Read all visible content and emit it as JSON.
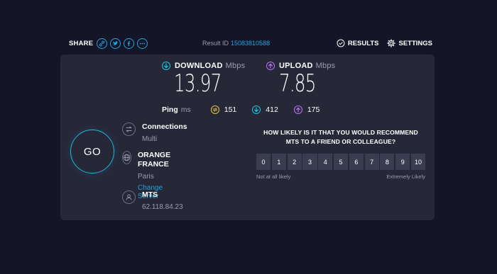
{
  "topbar": {
    "share_label": "SHARE",
    "share_buttons": [
      "link-icon",
      "twitter-icon",
      "facebook-icon",
      "more-icon"
    ],
    "result_id_label": "Result ID",
    "result_id": "15083810588",
    "results_label": "RESULTS",
    "settings_label": "SETTINGS"
  },
  "download": {
    "label": "DOWNLOAD",
    "unit": "Mbps",
    "value": "13.97",
    "color": "#19c8e0"
  },
  "upload": {
    "label": "UPLOAD",
    "unit": "Mbps",
    "value": "7.85",
    "color": "#b574f5"
  },
  "ping": {
    "label": "Ping",
    "unit": "ms",
    "idle": "151",
    "download": "412",
    "upload": "175",
    "idle_color": "#e6c547"
  },
  "go_label": "GO",
  "connections": {
    "title": "Connections",
    "value": "Multi"
  },
  "server": {
    "title": "ORANGE FRANCE",
    "location": "Paris",
    "change_label": "Change Server"
  },
  "provider": {
    "title": "MTS",
    "ip": "62.118.84.23"
  },
  "survey": {
    "question_line1": "HOW LIKELY IS IT THAT YOU WOULD RECOMMEND",
    "question_line2": "MTS TO A FRIEND OR COLLEAGUE?",
    "scale": [
      "0",
      "1",
      "2",
      "3",
      "4",
      "5",
      "6",
      "7",
      "8",
      "9",
      "10"
    ],
    "low_label": "Not at all likely",
    "high_label": "Extremely Likely"
  },
  "colors": {
    "accent": "#1fa3e0",
    "background": "#141526",
    "panel": "#262838"
  }
}
